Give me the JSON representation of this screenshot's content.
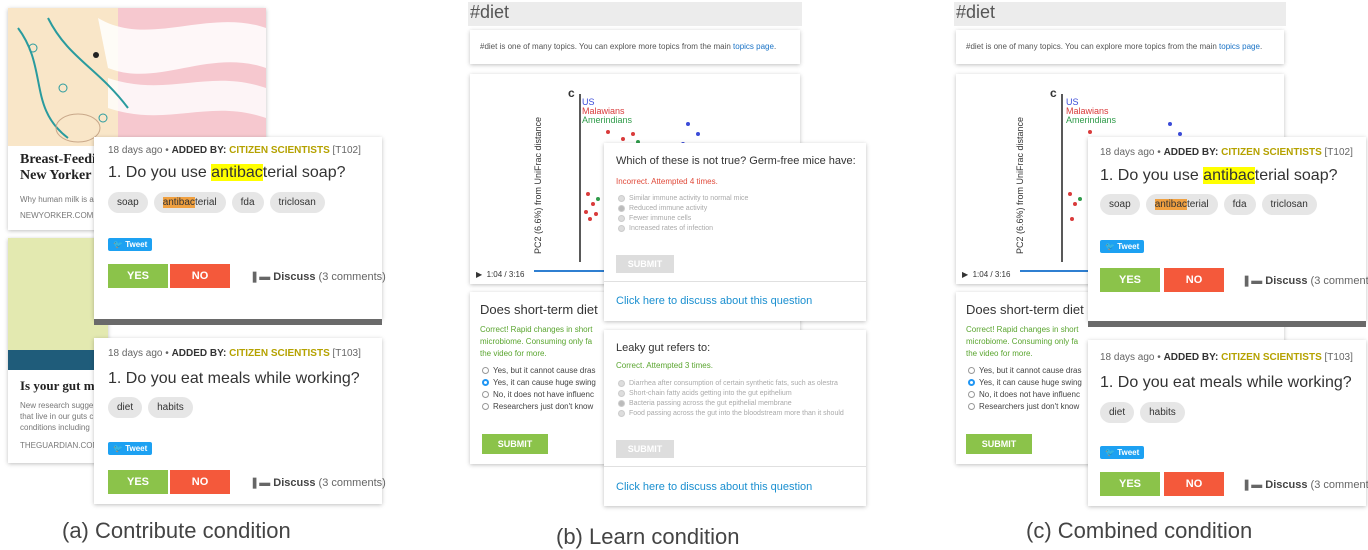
{
  "captions": {
    "a": "(a) Contribute condition",
    "b": "(b) Learn condition",
    "c": "(c) Combined condition"
  },
  "article1": {
    "title_line1": "Breast-Feedi",
    "title_line2": "New Yorker",
    "snippet": "Why human milk is a",
    "source": "NEWYORKER.COM ("
  },
  "article2": {
    "title": "Is your gut m",
    "snippet_lines": [
      "New research sugge",
      "that live in our guts c",
      "conditions including"
    ],
    "source": "THEGUARDIAN.COM"
  },
  "question_t102": {
    "age": "18 days ago •",
    "added_by": "ADDED BY:",
    "org": "CITIZEN SCIENTISTS",
    "code": "[T102]",
    "q_prefix": "1. Do you use ",
    "q_highlight": "antibac",
    "q_suffix": "terial soap?",
    "tags": [
      "soap",
      "antibac",
      "terial",
      "fda",
      "triclosan"
    ],
    "tweet": "Tweet",
    "yes": "YES",
    "no": "NO",
    "discuss": "Discuss",
    "comments": "(3 comments)"
  },
  "question_t103": {
    "age": "18 days ago •",
    "added_by": "ADDED BY:",
    "org": "CITIZEN SCIENTISTS",
    "code": "[T103]",
    "question": "1. Do you eat meals while working?",
    "tags": [
      "diet",
      "habits"
    ],
    "tweet": "Tweet",
    "yes": "YES",
    "no": "NO",
    "discuss": "Discuss",
    "comments": "(3 comments)"
  },
  "topic": {
    "header": "#diet",
    "line_prefix": "#diet is one of many topics. You can explore more topics from the main ",
    "link": "topics page",
    "line_suffix": "."
  },
  "figure": {
    "panel_letter": "c",
    "legend": [
      "US",
      "Malawians",
      "Amerindians"
    ],
    "ylabel": "PC2 (6.6%) from UniFrac distance"
  },
  "video": {
    "time": "1:04 / 3:16"
  },
  "quiz_main": {
    "question": "Does short-term diet",
    "feedback_lines": [
      "Correct! Rapid changes in short",
      "microbiome. Consuming only fa",
      "the video for more."
    ],
    "options": [
      "Yes, but it cannot cause dras",
      "Yes, it can cause huge swing",
      "No, it does not have influenc",
      "Researchers just don't know"
    ],
    "submit": "SUBMIT"
  },
  "quiz_germfree": {
    "question": "Which of these is not true? Germ-free mice have:",
    "status": "Incorrect. Attempted 4 times.",
    "options": [
      "Similar immune activity to normal mice",
      "Reduced immune activity",
      "Fewer immune cells",
      "Increased rates of infection"
    ],
    "submit": "SUBMIT",
    "discuss_link": "Click here to discuss about this question"
  },
  "quiz_leakygut": {
    "question": "Leaky gut refers to:",
    "status": "Correct. Attempted 3 times.",
    "options": [
      "Diarrhea after consumption of certain synthetic fats, such as olestra",
      "Short-chain fatty acids getting into the gut epithelium",
      "Bacteria passing across the gut epithelial membrane",
      "Food passing across the gut into the bloodstream more than it should"
    ],
    "submit": "SUBMIT",
    "discuss_link": "Click here to discuss about this question"
  },
  "colors": {
    "yes": "#8bc34a",
    "no": "#f4593b",
    "org": "#b5a200",
    "link": "#1a8fd0"
  }
}
